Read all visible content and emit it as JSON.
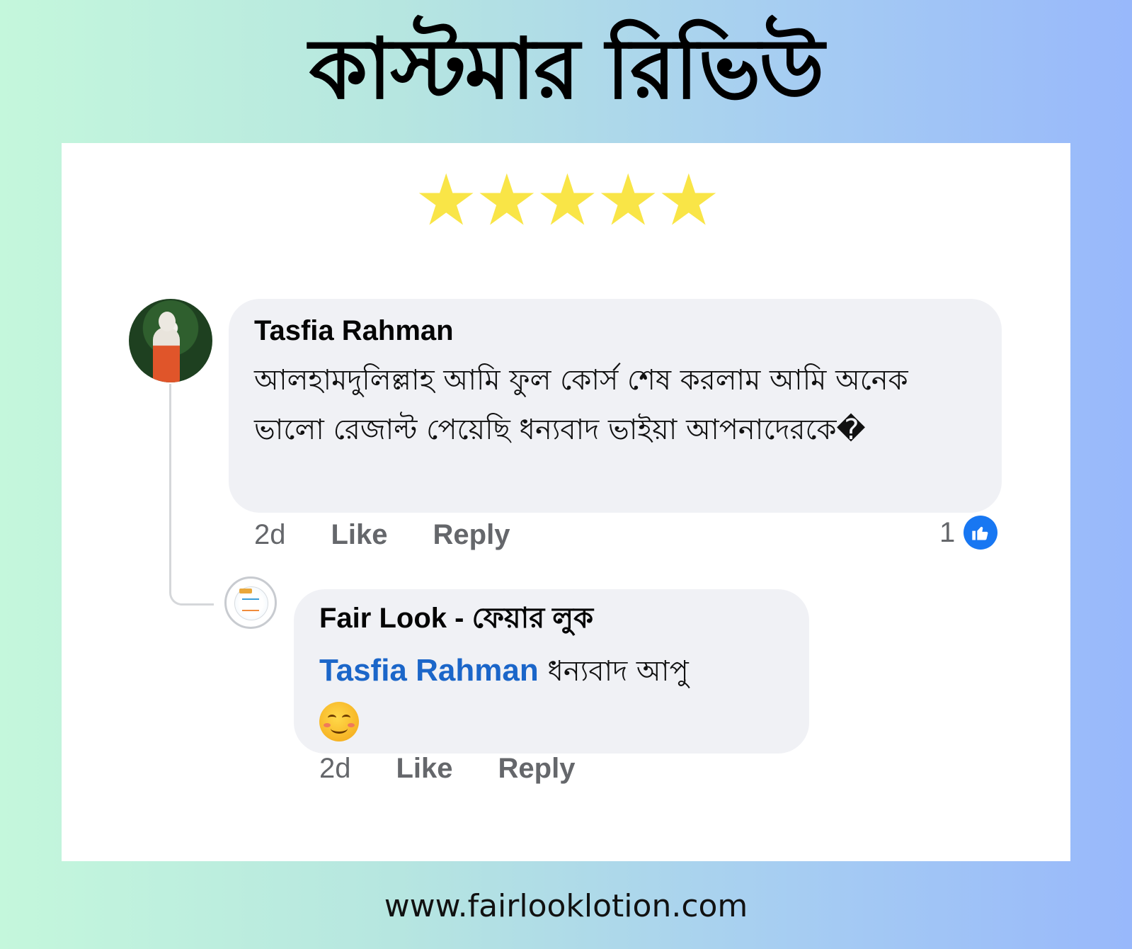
{
  "header": {
    "title": "কাস্টমার রিভিউ"
  },
  "rating": {
    "stars": 5,
    "max": 5,
    "star_color": "#f9e547"
  },
  "comment": {
    "author": "Tasfia Rahman",
    "text": "আলহামদুলিল্লাহ আমি ফুল কোর্স শেষ করলাম আমি অনেক ভালো রেজাল্ট পেয়েছি ধন্যবাদ ভাইয়া আপনাদেরকে�",
    "time": "2d",
    "like_label": "Like",
    "reply_label": "Reply",
    "reaction_count": "1"
  },
  "reply": {
    "author": "Fair Look - ফেয়ার লুক",
    "mention": "Tasfia Rahman",
    "text": "ধন্যবাদ আপু",
    "emoji": "smiling-face-icon",
    "time": "2d",
    "like_label": "Like",
    "reply_label": "Reply"
  },
  "footer": {
    "url": "www.fairlooklotion.com"
  },
  "colors": {
    "mention": "#1b66c9",
    "like_badge": "#1877f2",
    "bubble": "#f0f1f5"
  }
}
